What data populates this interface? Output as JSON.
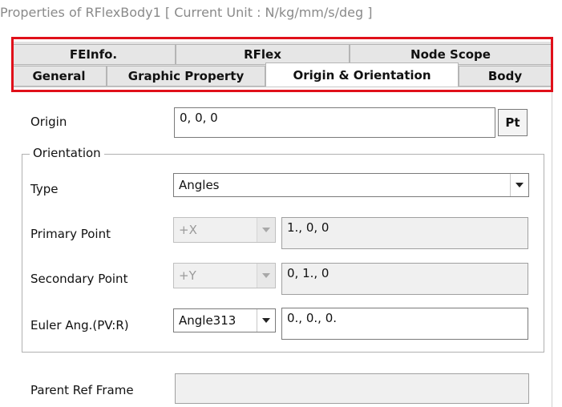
{
  "window": {
    "title": "Properties of RFlexBody1 [ Current Unit : N/kg/mm/s/deg ]"
  },
  "tabs": {
    "row1": [
      "FEInfo.",
      "RFlex",
      "Node Scope"
    ],
    "row2": [
      "General",
      "Graphic Property",
      "Origin & Orientation",
      "Body"
    ],
    "active": "Origin & Orientation"
  },
  "colors": {
    "highlight": "#e0101a"
  },
  "origin": {
    "label": "Origin",
    "value": "0, 0, 0",
    "pt_button": "Pt"
  },
  "orientation": {
    "group_title": "Orientation",
    "type": {
      "label": "Type",
      "value": "Angles"
    },
    "primary_point": {
      "label": "Primary Point",
      "axis": "+X",
      "value": "1., 0, 0"
    },
    "secondary_point": {
      "label": "Secondary Point",
      "axis": "+Y",
      "value": "0, 1., 0"
    },
    "euler": {
      "label": "Euler Ang.(PV:R)",
      "mode": "Angle313",
      "value": "0., 0., 0."
    }
  },
  "parent_ref_frame": {
    "label": "Parent Ref Frame",
    "value": ""
  }
}
